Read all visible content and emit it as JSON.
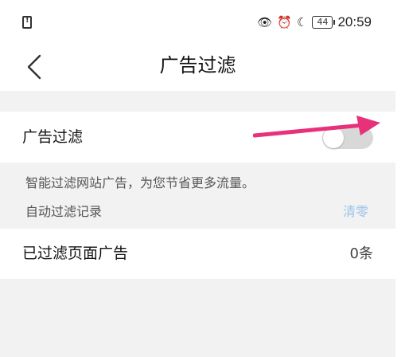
{
  "status_bar": {
    "battery": "44",
    "time": "20:59",
    "icons": [
      "sim-alert-icon",
      "eye-icon",
      "alarm-icon",
      "moon-icon",
      "battery-icon"
    ]
  },
  "header": {
    "title": "广告过滤",
    "back_icon": "chevron-left-icon"
  },
  "ad_filter": {
    "label": "广告过滤",
    "enabled": false,
    "description": "智能过滤网站广告，为您节省更多流量。"
  },
  "records": {
    "label": "自动过滤记录",
    "clear_label": "清零"
  },
  "filtered_count": {
    "label": "已过滤页面广告",
    "value": "0条"
  },
  "annotation": {
    "color": "#e8317a",
    "icon": "arrow-right-icon"
  },
  "colors": {
    "clear_link": "#9cc3ea",
    "switch_off": "#d8d8d8",
    "background": "#f2f2f2"
  }
}
